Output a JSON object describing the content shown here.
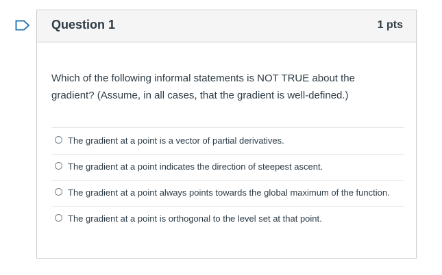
{
  "question": {
    "title": "Question 1",
    "points": "1 pts",
    "text": "Which of the following informal statements is NOT TRUE about the gradient? (Assume, in all cases, that the gradient is well-defined.)"
  },
  "answers": [
    {
      "label": "The gradient at a point is a vector of partial derivatives."
    },
    {
      "label": "The gradient at a point indicates the direction of steepest ascent."
    },
    {
      "label": "The gradient at a point always points towards the global maximum of the function."
    },
    {
      "label": "The gradient at a point is orthogonal to the level set at that point."
    }
  ],
  "colors": {
    "flag": "#2d7bb8",
    "header_bg": "#f5f5f5",
    "border": "#c7cdd1",
    "text": "#2d3b45"
  },
  "icons": {
    "flag": "bookmark-flag-icon",
    "radio": "radio-unselected-icon"
  }
}
